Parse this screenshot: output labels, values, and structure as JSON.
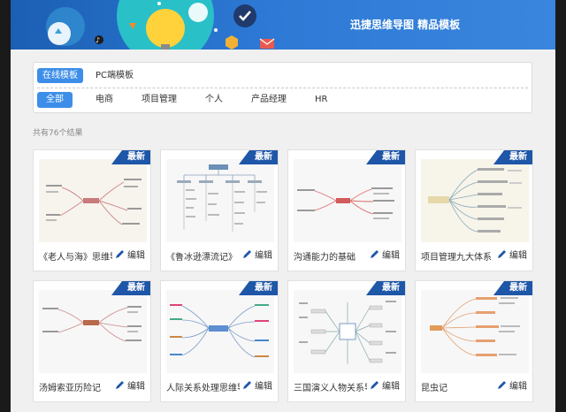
{
  "banner": {
    "title": "迅捷思维导图 精品模板"
  },
  "tabs": [
    {
      "label": "在线模板",
      "active": true
    },
    {
      "label": "PC端模板",
      "active": false
    }
  ],
  "categories": [
    {
      "label": "全部",
      "active": true
    },
    {
      "label": "电商",
      "active": false
    },
    {
      "label": "项目管理",
      "active": false
    },
    {
      "label": "个人",
      "active": false
    },
    {
      "label": "产品经理",
      "active": false
    },
    {
      "label": "HR",
      "active": false
    }
  ],
  "results": {
    "count_text": "共有76个结果"
  },
  "badge_label": "最新",
  "edit_label": "编辑",
  "colors": {
    "banner": "#2c78d4",
    "accent": "#3d8ee8",
    "badge": "#1e56a8",
    "edit_icon": "#1e56a8"
  },
  "cards": [
    {
      "title": "《老人与海》思维导图"
    },
    {
      "title": "《鲁冰逊漂流记》"
    },
    {
      "title": "沟通能力的基础"
    },
    {
      "title": "项目管理九大体系"
    },
    {
      "title": "汤姆索亚历险记"
    },
    {
      "title": "人际关系处理思维导图"
    },
    {
      "title": "三国演义人物关系导图"
    },
    {
      "title": "昆虫记"
    }
  ]
}
